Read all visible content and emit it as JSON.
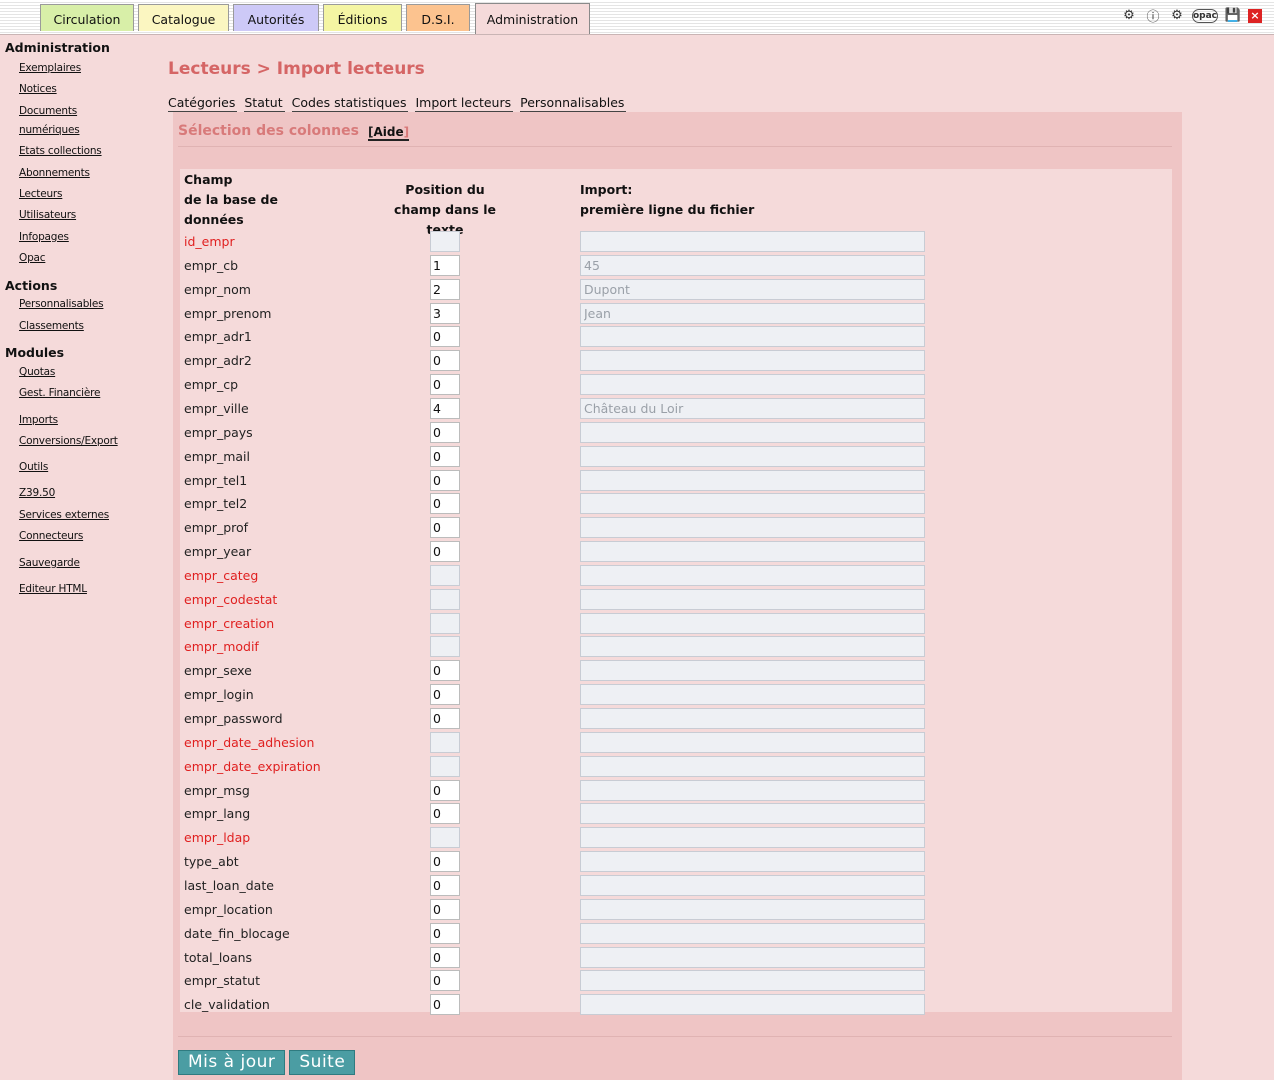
{
  "tabs": [
    {
      "label": "Circulation"
    },
    {
      "label": "Catalogue"
    },
    {
      "label": "Autorités"
    },
    {
      "label": "Éditions"
    },
    {
      "label": "D.S.I."
    },
    {
      "label": "Administration"
    }
  ],
  "top_icons": [
    "world-icon",
    "help-icon",
    "gear-icon",
    "opac-icon",
    "save-icon",
    "close-icon"
  ],
  "opac_icon_label": "opac",
  "sidebar": {
    "administration": {
      "heading": "Administration",
      "items": [
        "Exemplaires",
        "Notices",
        "Documents",
        "numériques",
        "Etats collections",
        "Abonnements",
        "Lecteurs",
        "Utilisateurs",
        "Infopages",
        "Opac"
      ]
    },
    "actions": {
      "heading": "Actions",
      "items": [
        "Personnalisables",
        "Classements"
      ]
    },
    "modules": {
      "heading": "Modules",
      "items": [
        "Quotas",
        "Gest. Financière",
        "Imports",
        "Conversions/Export",
        "Outils",
        "Z39.50",
        "Services externes",
        "Connecteurs",
        "Sauvegarde",
        "Editeur HTML"
      ]
    }
  },
  "page": {
    "title": "Lecteurs > Import lecteurs",
    "subtabs": [
      "Catégories",
      "Statut",
      "Codes statistiques",
      "Import lecteurs",
      "Personnalisables"
    ],
    "section_title": "Sélection des colonnes",
    "help_link": "Aide",
    "headers": {
      "field_1": "Champ",
      "field_2": "de la base de",
      "field_3": "données",
      "position_1": "Position du",
      "position_2": "champ dans le texte",
      "import_1": "Import:",
      "import_2": "première ligne du fichier"
    }
  },
  "rows": [
    {
      "field": "id_empr",
      "required": true,
      "position": "",
      "disabled": true,
      "preview": ""
    },
    {
      "field": "empr_cb",
      "required": false,
      "position": "1",
      "disabled": false,
      "preview": "45"
    },
    {
      "field": "empr_nom",
      "required": false,
      "position": "2",
      "disabled": false,
      "preview": "Dupont"
    },
    {
      "field": "empr_prenom",
      "required": false,
      "position": "3",
      "disabled": false,
      "preview": "Jean"
    },
    {
      "field": "empr_adr1",
      "required": false,
      "position": "0",
      "disabled": false,
      "preview": ""
    },
    {
      "field": "empr_adr2",
      "required": false,
      "position": "0",
      "disabled": false,
      "preview": ""
    },
    {
      "field": "empr_cp",
      "required": false,
      "position": "0",
      "disabled": false,
      "preview": ""
    },
    {
      "field": "empr_ville",
      "required": false,
      "position": "4",
      "disabled": false,
      "preview": "Château du Loir"
    },
    {
      "field": "empr_pays",
      "required": false,
      "position": "0",
      "disabled": false,
      "preview": ""
    },
    {
      "field": "empr_mail",
      "required": false,
      "position": "0",
      "disabled": false,
      "preview": ""
    },
    {
      "field": "empr_tel1",
      "required": false,
      "position": "0",
      "disabled": false,
      "preview": ""
    },
    {
      "field": "empr_tel2",
      "required": false,
      "position": "0",
      "disabled": false,
      "preview": ""
    },
    {
      "field": "empr_prof",
      "required": false,
      "position": "0",
      "disabled": false,
      "preview": ""
    },
    {
      "field": "empr_year",
      "required": false,
      "position": "0",
      "disabled": false,
      "preview": ""
    },
    {
      "field": "empr_categ",
      "required": true,
      "position": "",
      "disabled": true,
      "preview": ""
    },
    {
      "field": "empr_codestat",
      "required": true,
      "position": "",
      "disabled": true,
      "preview": ""
    },
    {
      "field": "empr_creation",
      "required": true,
      "position": "",
      "disabled": true,
      "preview": ""
    },
    {
      "field": "empr_modif",
      "required": true,
      "position": "",
      "disabled": true,
      "preview": ""
    },
    {
      "field": "empr_sexe",
      "required": false,
      "position": "0",
      "disabled": false,
      "preview": ""
    },
    {
      "field": "empr_login",
      "required": false,
      "position": "0",
      "disabled": false,
      "preview": ""
    },
    {
      "field": "empr_password",
      "required": false,
      "position": "0",
      "disabled": false,
      "preview": ""
    },
    {
      "field": "empr_date_adhesion",
      "required": true,
      "position": "",
      "disabled": true,
      "preview": ""
    },
    {
      "field": "empr_date_expiration",
      "required": true,
      "position": "",
      "disabled": true,
      "preview": ""
    },
    {
      "field": "empr_msg",
      "required": false,
      "position": "0",
      "disabled": false,
      "preview": ""
    },
    {
      "field": "empr_lang",
      "required": false,
      "position": "0",
      "disabled": false,
      "preview": ""
    },
    {
      "field": "empr_ldap",
      "required": true,
      "position": "",
      "disabled": true,
      "preview": ""
    },
    {
      "field": "type_abt",
      "required": false,
      "position": "0",
      "disabled": false,
      "preview": ""
    },
    {
      "field": "last_loan_date",
      "required": false,
      "position": "0",
      "disabled": false,
      "preview": ""
    },
    {
      "field": "empr_location",
      "required": false,
      "position": "0",
      "disabled": false,
      "preview": ""
    },
    {
      "field": "date_fin_blocage",
      "required": false,
      "position": "0",
      "disabled": false,
      "preview": ""
    },
    {
      "field": "total_loans",
      "required": false,
      "position": "0",
      "disabled": false,
      "preview": ""
    },
    {
      "field": "empr_statut",
      "required": false,
      "position": "0",
      "disabled": false,
      "preview": ""
    },
    {
      "field": "cle_validation",
      "required": false,
      "position": "0",
      "disabled": false,
      "preview": ""
    }
  ],
  "buttons": {
    "update": "Mis à jour",
    "next": "Suite"
  },
  "colors": {
    "background": "#f5dada",
    "accent_title": "#d56565",
    "required_field": "#e02020",
    "button": "#4b9da3"
  }
}
